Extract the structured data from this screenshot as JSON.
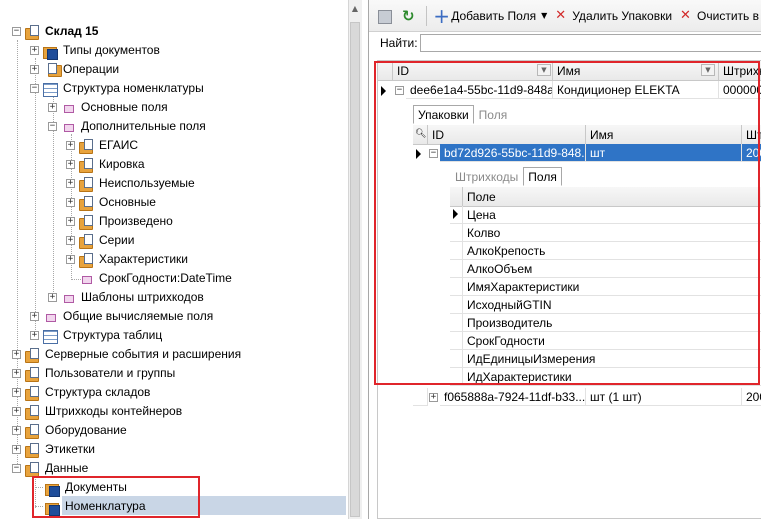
{
  "tree": {
    "root": "Склад 15",
    "items": [
      "Типы документов",
      "Операции",
      "Структура номенклатуры",
      "Основные поля",
      "Дополнительные поля",
      "ЕГАИС",
      "Кировка",
      "Неиспользуемые",
      "Основные",
      "Произведено",
      "Серии",
      "Характеристики",
      "СрокГодности:DateTime",
      "Шаблоны штрихкодов",
      "Общие вычисляемые поля",
      "Структура таблиц",
      "Серверные события и расширения",
      "Пользователи и группы",
      "Структура складов",
      "Штрихкоды контейнеров",
      "Оборудование",
      "Этикетки",
      "Данные",
      "Документы",
      "Номенклатура"
    ]
  },
  "toolbar": {
    "add_fields": "Добавить Поля",
    "delete_packages": "Удалить Упаковки",
    "clear": "Очистить в"
  },
  "search": {
    "label": "Найти:",
    "value": ""
  },
  "grid": {
    "headers": {
      "id": "ID",
      "name": "Имя",
      "barcode": "Штрихко"
    },
    "row": {
      "id": "dee6e1a4-55bc-11d9-848a...",
      "name": "Кондиционер ELEKTA",
      "barcode": "000000"
    },
    "detail_tabs": {
      "packages": "Упаковки",
      "fields": "Поля"
    },
    "detail_headers": {
      "id": "ID",
      "name": "Имя",
      "barcode": "Штр"
    },
    "detail_rows": [
      {
        "id": "bd72d926-55bc-11d9-848...",
        "name": "шт",
        "barcode": "200"
      },
      {
        "id": "f065888a-7924-11df-b33...",
        "name": "шт (1 шт)",
        "barcode": "200"
      }
    ],
    "inner_tabs": {
      "barcodes": "Штрихкоды",
      "fields": "Поля"
    },
    "inner_header": "Поле",
    "inner_fields": [
      "Цена",
      "Колво",
      "АлкоКрепость",
      "АлкоОбъем",
      "ИмяХарактеристики",
      "ИсходныйGTIN",
      "Производитель",
      "СрокГодности",
      "ИдЕдиницыИзмерения",
      "ИдХарактеристики"
    ]
  },
  "colors": {
    "highlight": "#e0252b",
    "selection": "#2f74c6",
    "tree_selection": "#c9d6e6"
  }
}
